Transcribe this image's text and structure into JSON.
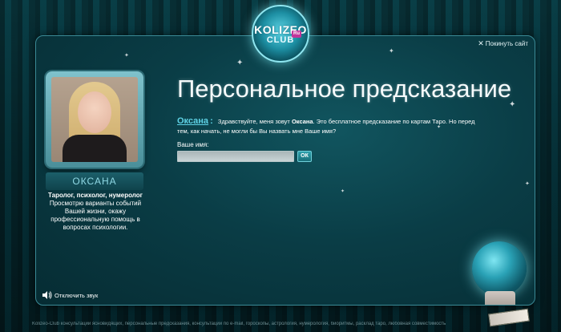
{
  "logo": {
    "line1": "KOLIZEO",
    "line2": "CLUB",
    "badge": "Ru"
  },
  "header": {
    "leave_label": "Покинуть сайт",
    "title": "Персональное предсказание"
  },
  "consultant": {
    "name": "ОКСАНА",
    "role": "Таролог, психолог, нумеролог",
    "description": "Просмотрю варианты событий Вашей жизни, окажу профессиональную помощь в вопросах психологии."
  },
  "intro": {
    "speaker": "Оксана",
    "colon": ":",
    "text_before": "Здравствуйте, меня зовут",
    "text_name": "Оксана",
    "text_after": ". Это бесплатное предсказание по картам Таро. Но перед тем, как начать, не могли бы Вы назвать мне Ваше имя?"
  },
  "form": {
    "label": "Ваше имя:",
    "name_value": "",
    "ok_label": "ОК"
  },
  "sound": {
    "label": "Отключить звук"
  },
  "footer": {
    "text": "Kolizeo-Club консультации ясновидящих, персональные предсказания, консультации по e-mail, гороскопы, астрология, нумерология, биоритмы, расклад таро, любовная совместимость"
  }
}
